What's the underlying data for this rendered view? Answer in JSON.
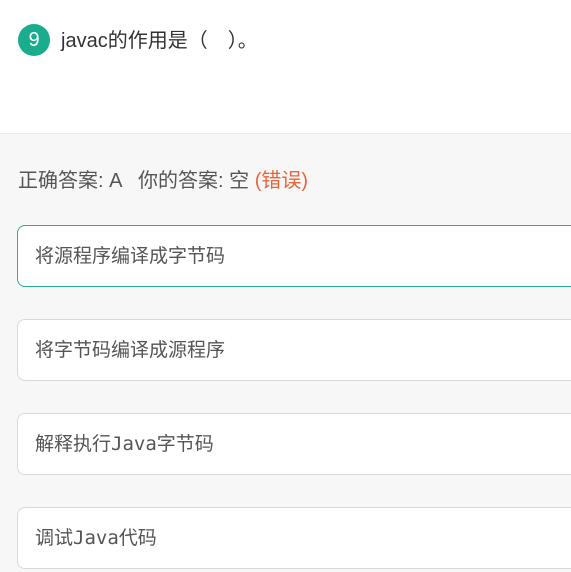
{
  "question": {
    "number": "9",
    "text": "javac的作用是（　）。"
  },
  "answer": {
    "correct_label": "正确答案:",
    "correct_value": "A",
    "your_label": "你的答案:",
    "your_value": "空",
    "status": "(错误)"
  },
  "options": [
    {
      "text": "将源程序编译成字节码",
      "correct": true
    },
    {
      "text": "将字节码编译成源程序"
    },
    {
      "text": "解释执行Java字节码"
    },
    {
      "text": "调试Java代码"
    }
  ],
  "colors": {
    "accent": "#1aad8d",
    "error": "#e8643c"
  }
}
